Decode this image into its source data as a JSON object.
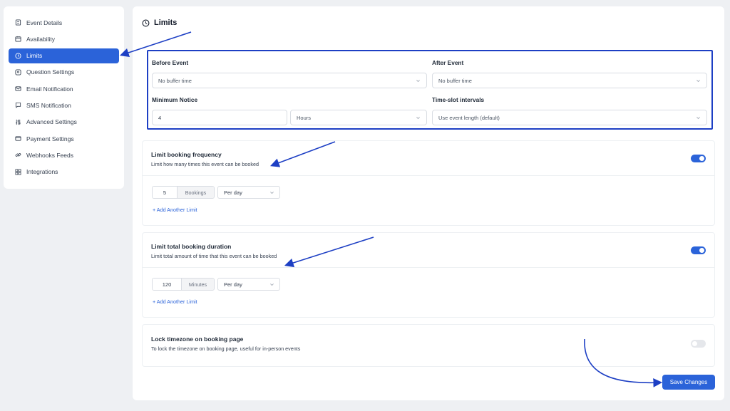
{
  "sidebar": {
    "items": [
      {
        "label": "Event Details",
        "icon": "document-icon"
      },
      {
        "label": "Availability",
        "icon": "calendar-icon"
      },
      {
        "label": "Limits",
        "icon": "clock-icon",
        "active": true
      },
      {
        "label": "Question Settings",
        "icon": "question-icon"
      },
      {
        "label": "Email Notification",
        "icon": "mail-icon"
      },
      {
        "label": "SMS Notification",
        "icon": "message-icon"
      },
      {
        "label": "Advanced Settings",
        "icon": "sliders-icon"
      },
      {
        "label": "Payment Settings",
        "icon": "card-icon"
      },
      {
        "label": "Webhooks Feeds",
        "icon": "link-icon"
      },
      {
        "label": "Integrations",
        "icon": "grid-icon"
      }
    ]
  },
  "main": {
    "title": "Limits",
    "before_event": {
      "label": "Before Event",
      "value": "No buffer time"
    },
    "after_event": {
      "label": "After Event",
      "value": "No buffer time"
    },
    "minimum_notice": {
      "label": "Minimum Notice",
      "value": "4",
      "unit": "Hours"
    },
    "time_slot": {
      "label": "Time-slot intervals",
      "value": "Use event length (default)"
    },
    "frequency": {
      "title": "Limit booking frequency",
      "description": "Limit how many times this event can be booked",
      "enabled": true,
      "count": "5",
      "unit": "Bookings",
      "period": "Per day",
      "add_label": "+ Add Another Limit"
    },
    "duration": {
      "title": "Limit total booking duration",
      "description": "Limit total amount of time that this event can be booked",
      "enabled": true,
      "count": "120",
      "unit": "Minutes",
      "period": "Per day",
      "add_label": "+ Add Another Limit"
    },
    "timezone": {
      "title": "Lock timezone on booking page",
      "description": "To lock the timezone on booking page, useful for in-person events",
      "enabled": false
    },
    "save_label": "Save Changes"
  },
  "colors": {
    "accent": "#2b63d9",
    "annotation": "#1d3fc4"
  }
}
